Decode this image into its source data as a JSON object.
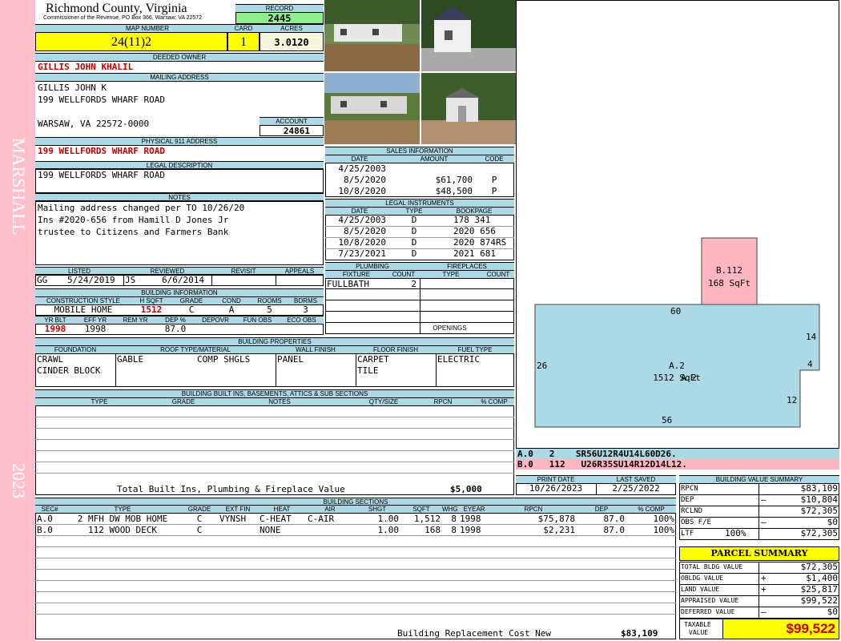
{
  "side": {
    "district": "MARSHALL",
    "year": "2023"
  },
  "header": {
    "county": "Richmond County, Virginia",
    "commissioner": "Commissioner of the Revenue, PO Box 366, Warsaw, VA 22572",
    "record_label": "RECORD",
    "record": "2445"
  },
  "map": {
    "map_label": "MAP NUMBER",
    "map_number": "24(11)2",
    "card_label": "CARD",
    "card": "1",
    "acres_label": "ACRES",
    "acres": "3.0120"
  },
  "owner": {
    "label": "DEEDED OWNER",
    "name": "GILLIS JOHN KHALIL"
  },
  "mailing": {
    "label": "MAILING ADDRESS",
    "line1": "GILLIS JOHN K",
    "line2": "199 WELLFORDS WHARF ROAD",
    "line3": "WARSAW, VA 22572-0000",
    "account_label": "ACCOUNT",
    "account": "24861"
  },
  "physical": {
    "label": "PHYSICAL 911 ADDRESS",
    "address": "199 WELLFORDS WHARF ROAD"
  },
  "legal": {
    "label": "LEGAL DESCRIPTION",
    "text": "199 WELLFORDS WHARF ROAD"
  },
  "notes": {
    "label": "NOTES",
    "line1": "Mailing address changed per TO 10/26/20",
    "line2": "Ins #2020-656 from Hamill D Jones Jr",
    "line3": "trustee to Citizens and Farmers Bank"
  },
  "listed": {
    "listed_label": "LISTED",
    "listed_by": "GG",
    "listed_date": "5/24/2019",
    "reviewed_label": "REVIEWED",
    "reviewed_by": "JS",
    "reviewed_date": "6/6/2014",
    "revisit_label": "REVISIT",
    "appeals_label": "APPEALS"
  },
  "building_info": {
    "label": "BUILDING INFORMATION",
    "h_style": "CONSTRUCTION STYLE",
    "h_sqft": "H SQFT",
    "h_grade": "GRADE",
    "h_cond": "COND",
    "h_rooms": "ROOMS",
    "h_bdrms": "BDRMS",
    "style": "MOBILE HOME",
    "sqft": "1512",
    "grade": "C",
    "cond": "A",
    "rooms": "5",
    "bdrms": "3",
    "h_yrblt": "YR BLT",
    "h_effyr": "EFF YR",
    "h_remyr": "REM YR",
    "h_dep": "DEP %",
    "h_depovr": "DEPOVR",
    "h_funobs": "FUN OBS",
    "h_ecoobs": "ECO OBS",
    "yrblt": "1998",
    "effyr": "1998",
    "dep": "87.0"
  },
  "sales": {
    "label": "SALES INFORMATION",
    "h_date": "DATE",
    "h_amount": "AMOUNT",
    "h_code": "CODE",
    "rows": [
      {
        "date": "4/25/2003",
        "amount": "",
        "code": ""
      },
      {
        "date": "8/5/2020",
        "amount": "$61,700",
        "code": "P"
      },
      {
        "date": "10/8/2020",
        "amount": "$48,500",
        "code": "P"
      }
    ]
  },
  "instruments": {
    "label": "LEGAL INSTRUMENTS",
    "h_date": "DATE",
    "h_type": "TYPE",
    "h_book": "BOOKPAGE",
    "rows": [
      {
        "date": "4/25/2003",
        "type": "D",
        "book": "178 341"
      },
      {
        "date": "8/5/2020",
        "type": "D",
        "book": "2020 656"
      },
      {
        "date": "10/8/2020",
        "type": "D",
        "book": "2020 874RS"
      },
      {
        "date": "7/23/2021",
        "type": "D",
        "book": "2021 681"
      }
    ]
  },
  "plumbing": {
    "label": "PLUMBING",
    "h_fixture": "FIXTURE",
    "h_count": "COUNT",
    "fixture": "FULLBATH",
    "count": "2"
  },
  "fireplaces": {
    "label": "FIREPLACES",
    "h_type": "TYPE",
    "h_count": "COUNT",
    "openings_label": "OPENINGS"
  },
  "properties": {
    "label": "BUILDING PROPERTIES",
    "h_foundation": "FOUNDATION",
    "h_roof": "ROOF TYPE/MATERIAL",
    "h_wall": "WALL FINISH",
    "h_floor": "FLOOR FINISH",
    "h_fuel": "FUEL TYPE",
    "foundation1": "CRAWL",
    "foundation2": "CINDER BLOCK",
    "roof_type": "GABLE",
    "roof_material": "COMP SHGLS",
    "wall": "PANEL",
    "floor1": "CARPET",
    "floor2": "TILE",
    "fuel": "ELECTRIC"
  },
  "builtins": {
    "label": "BUILDING BUILT INS, BASEMENTS, ATTICS & SUB SECTIONS",
    "h_type": "TYPE",
    "h_grade": "GRADE",
    "h_notes": "NOTES",
    "h_qty": "QTY/SIZE",
    "h_rpcn": "RPCN",
    "h_comp": "% COMP",
    "total_label": "Total Built Ins, Plumbing & Fireplace Value",
    "total": "$5,000"
  },
  "sections": {
    "label": "BUILDING SECTIONS",
    "headers": [
      "SEC#",
      "TYPE",
      "GRADE",
      "EXT FIN",
      "HEAT",
      "AIR",
      "SHGT",
      "SQFT",
      "WHGT",
      "EYEAR",
      "RPCN",
      "DEP",
      "% COMP"
    ],
    "rows": [
      [
        "A.0",
        "2 MFH DW MOB HOME",
        "C",
        "VYNSH",
        "C-HEAT",
        "C-AIR",
        "1.00",
        "1,512",
        "8",
        "1998",
        "$75,878",
        "87.0",
        "100%"
      ],
      [
        "B.0",
        "112 WOOD DECK",
        "C",
        "",
        "NONE",
        "",
        "1.00",
        "168",
        "8",
        "1998",
        "$2,231",
        "87.0",
        "100%"
      ]
    ],
    "replacement_label": "Building Replacement Cost New",
    "replacement": "$83,109"
  },
  "sketch": {
    "a_label": "A.2",
    "a_area": "1512 SqFt",
    "b_label": "B.112",
    "b_area": "168 SqFt",
    "dims": [
      "60",
      "14",
      "4",
      "12",
      "56",
      "26"
    ],
    "code_a": "A.0   2    SR56U12R4U14L60D26.",
    "code_b": "B.0   112   U26R35SU14R12D14L12."
  },
  "print": {
    "print_label": "PRINT DATE",
    "print_date": "10/26/2023",
    "saved_label": "LAST SAVED",
    "saved_date": "2/25/2022"
  },
  "value_summary": {
    "label": "BUILDING VALUE SUMMARY",
    "rows": [
      {
        "k": "RPCN",
        "sign": "",
        "v": "$83,109"
      },
      {
        "k": "DEP",
        "sign": "–",
        "v": "$10,804"
      },
      {
        "k": "RCLND",
        "sign": "",
        "v": "$72,305"
      },
      {
        "k": "OBS F/E",
        "sign": "–",
        "v": "$0"
      },
      {
        "k": "LTF",
        "sign": "100%",
        "v": "$72,305"
      }
    ]
  },
  "parcel": {
    "label": "PARCEL SUMMARY",
    "rows": [
      {
        "k": "TOTAL BLDG VALUE",
        "sign": "",
        "v": "$72,305"
      },
      {
        "k": "OBLDG VALUE",
        "sign": "+",
        "v": "$1,400"
      },
      {
        "k": "LAND VALUE",
        "sign": "+",
        "v": "$25,817"
      },
      {
        "k": "APPRAISED VALUE",
        "sign": "",
        "v": "$99,522"
      },
      {
        "k": "DEFERRED VALUE",
        "sign": "–",
        "v": "$0"
      }
    ],
    "taxable_label1": "TAXABLE",
    "taxable_label2": "VALUE",
    "taxable": "$99,522"
  },
  "colors": {
    "sidebar": "#ffc0cb",
    "header": "#add8e6",
    "record": "#90ee90",
    "highlight": "#ffff00",
    "sketch_a": "#add8e6",
    "sketch_b": "#ffb6c1"
  }
}
